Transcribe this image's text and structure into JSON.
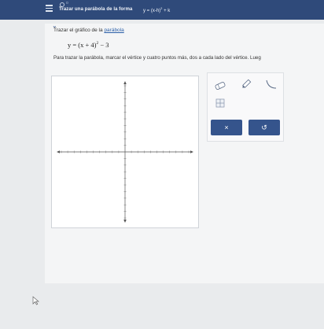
{
  "header": {
    "subtitle": "o",
    "title": "Trazar una parábola de la forma",
    "formula_main": "y = (x-h)",
    "formula_exp": "2",
    "formula_tail": "+ k"
  },
  "problem": {
    "intro_prefix": "Trazar el gráfico de la ",
    "intro_link": "parábola",
    "equation_main": "y = (x + 4)",
    "equation_exp": "2",
    "equation_tail": " − 3",
    "instruction": "Para trazar la parábola, marcar el vértice y cuatro puntos más, dos a cada lado del vértice. Lueg"
  },
  "graph": {
    "x_range": [
      -10,
      10
    ],
    "y_range": [
      -10,
      10
    ]
  },
  "tools": {
    "eraser_icon": "eraser-icon",
    "pencil_icon": "pencil-icon",
    "parabola_icon": "parabola-icon",
    "grid_icon": "grid-icon"
  },
  "buttons": {
    "clear_label": "×",
    "undo_label": "↺"
  },
  "colors": {
    "header_bg": "#2f4a7a",
    "button_bg": "#35548c",
    "link": "#2b5fa8"
  }
}
